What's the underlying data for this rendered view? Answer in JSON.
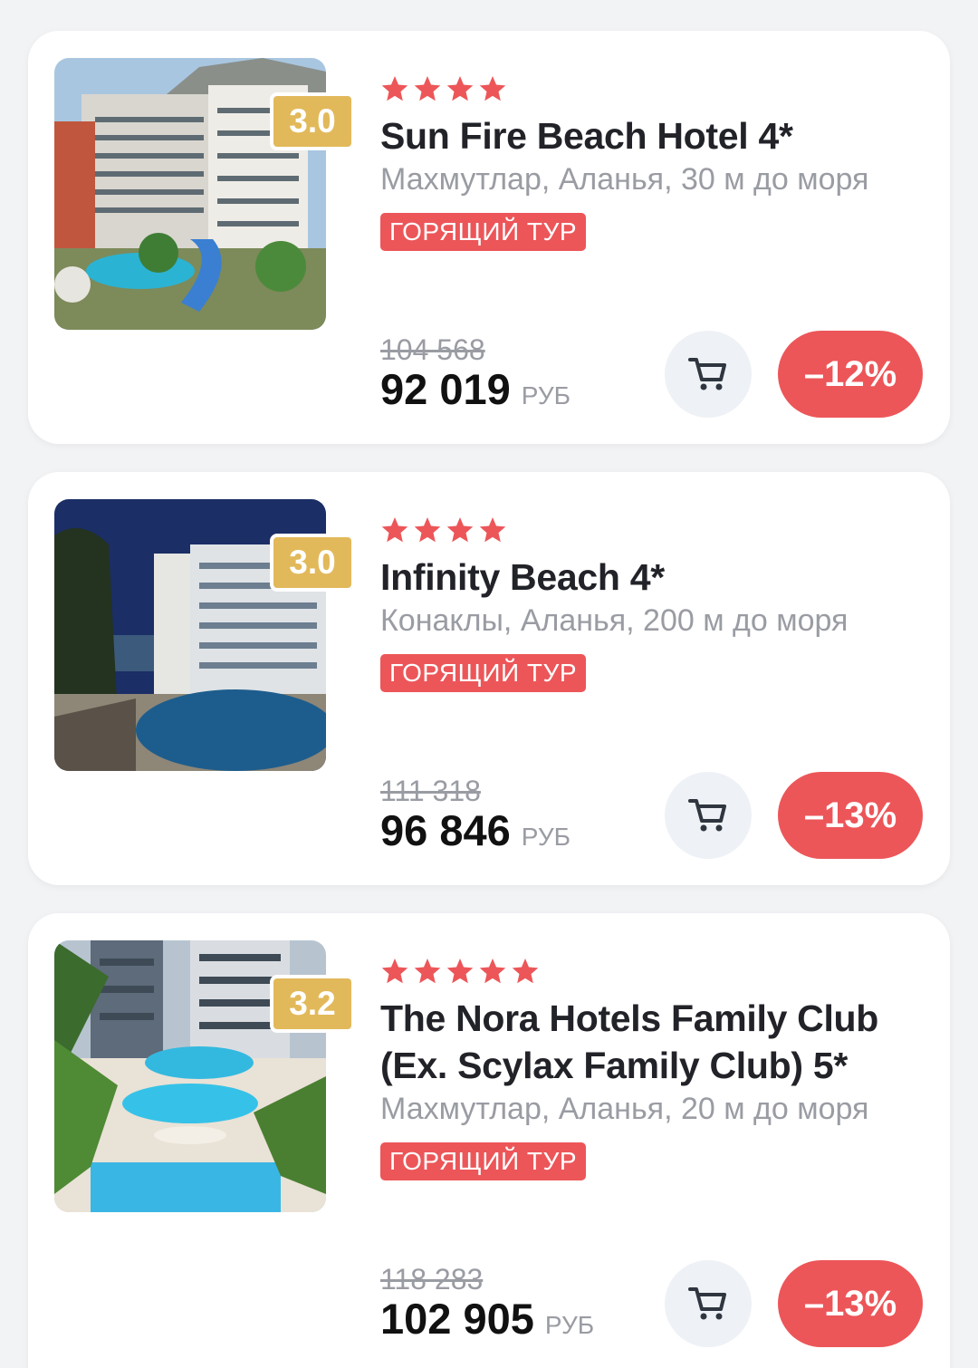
{
  "colors": {
    "accent_red": "#ec5659",
    "rating_gold": "#e2b95a",
    "muted_gray": "#9a9ca3",
    "card_bg": "#ffffff",
    "page_bg": "#f2f3f5"
  },
  "hotels": [
    {
      "stars": 4,
      "rating": "3.0",
      "name": "Sun Fire Beach Hotel 4*",
      "location": "Махмутлар, Аланья, 30 м до моря",
      "badge": "ГОРЯЩИЙ ТУР",
      "old_price": "104 568",
      "price": "92 019",
      "currency": "РУБ",
      "discount": "–12%",
      "cart_icon": "cart-icon"
    },
    {
      "stars": 4,
      "rating": "3.0",
      "name": "Infinity Beach 4*",
      "location": "Конаклы, Аланья, 200 м до моря",
      "badge": "ГОРЯЩИЙ ТУР",
      "old_price": "111 318",
      "price": "96 846",
      "currency": "РУБ",
      "discount": "–13%",
      "cart_icon": "cart-icon"
    },
    {
      "stars": 5,
      "rating": "3.2",
      "name": "The Nora Hotels Family Club (Ex. Scylax Family Club) 5*",
      "location": "Махмутлар, Аланья, 20 м до моря",
      "badge": "ГОРЯЩИЙ ТУР",
      "old_price": "118 283",
      "price": "102 905",
      "currency": "РУБ",
      "discount": "–13%",
      "cart_icon": "cart-icon"
    }
  ]
}
